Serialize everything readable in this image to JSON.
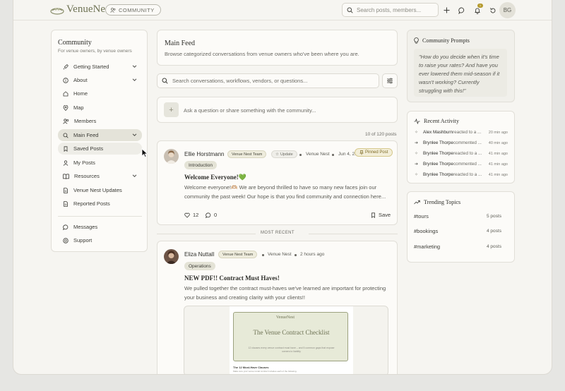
{
  "header": {
    "logo_text": "VenueNest",
    "community_label": "COMMUNITY",
    "search_placeholder": "Search posts, members...",
    "notification_count": "1",
    "avatar_initials": "BG"
  },
  "sidebar": {
    "title": "Community",
    "subtitle": "For venue owners, by venue owners",
    "items": [
      {
        "label": "Getting Started",
        "icon": "rocket-icon",
        "chevron": true
      },
      {
        "label": "About",
        "icon": "info-icon",
        "chevron": true
      },
      {
        "label": "Home",
        "icon": "home-icon",
        "chevron": false
      },
      {
        "label": "Map",
        "icon": "map-pin-icon",
        "chevron": false
      },
      {
        "label": "Members",
        "icon": "users-icon",
        "chevron": false
      },
      {
        "label": "Main Feed",
        "icon": "search-icon",
        "chevron": true
      },
      {
        "label": "Saved Posts",
        "icon": "bookmark-icon",
        "chevron": false
      },
      {
        "label": "My Posts",
        "icon": "user-icon",
        "chevron": false
      },
      {
        "label": "Resources",
        "icon": "book-icon",
        "chevron": true
      },
      {
        "label": "Venue Nest Updates",
        "icon": "document-icon",
        "chevron": false
      },
      {
        "label": "Reported Posts",
        "icon": "flag-icon",
        "chevron": false
      }
    ],
    "bottom_items": [
      {
        "label": "Messages",
        "icon": "message-icon"
      },
      {
        "label": "Support",
        "icon": "help-icon"
      }
    ]
  },
  "main": {
    "title": "Main Feed",
    "subtitle": "Browse categorized conversations from venue owners who've been where you are.",
    "search_placeholder": "Search conversations, workflows, vendors, or questions...",
    "compose_placeholder": "Ask a question or share something with the community...",
    "count_text": "10 of 120 posts",
    "divider_label": "MOST RECENT",
    "posts": [
      {
        "author": "Ellie Horstmann",
        "team_tag": "Venue Nest Team",
        "update_tag": "Update",
        "source": "Venue Nest",
        "date": "Jun 4, 2...",
        "pinned_label": "Pinned Post",
        "category": "Introduction",
        "title": "Welcome Everyone!💚",
        "body": "Welcome everyone!🫶🏼 We are beyond thrilled to have so many new faces join our community the past week! Our hope is that you find community and connection here...",
        "likes": "12",
        "comments": "0",
        "save_label": "Save"
      },
      {
        "author": "Eliza Nuttall",
        "team_tag": "Venue Nest Team",
        "source": "Venue Nest",
        "time": "2 hours ago",
        "category": "Operations",
        "title": "NEW PDF!! Contract Must Haves!",
        "body": "We pulled together the contract must-haves we've learned are important for protecting your business and creating clarity with your clients!!",
        "doc": {
          "logo": "VenueNest",
          "title": "The Venue Contract Checklist",
          "small": "12 clauses every venue contract must have – and 5 common gaps that expose owners to liability",
          "heading": "The 12 Must-Have Clauses",
          "line": "Make sure your venue rental contract includes each of the following."
        }
      }
    ]
  },
  "prompts": {
    "title": "Community Prompts",
    "quote": "\"How do you decide when it's time to raise your rates? And have you ever lowered them mid-season if it wasn't working? Currently struggling with this!\""
  },
  "activity": {
    "title": "Recent Activity",
    "rows": [
      {
        "who": "Alex Mashburn",
        "what": " reacted to a ...",
        "time": "20 min ago"
      },
      {
        "who": "Brynlee Thorpe",
        "what": " commented ...",
        "time": "40 min ago"
      },
      {
        "who": "Brynlee Thorpe",
        "what": " reacted to a ...",
        "time": "41 min ago"
      },
      {
        "who": "Brynlee Thorpe",
        "what": " commented ...",
        "time": "41 min ago"
      },
      {
        "who": "Brynlee Thorpe",
        "what": " reacted to a ...",
        "time": "41 min ago"
      }
    ]
  },
  "trending": {
    "title": "Trending Topics",
    "topics": [
      {
        "tag": "#tours",
        "count": "5 posts"
      },
      {
        "tag": "#bookings",
        "count": "4 posts"
      },
      {
        "tag": "#marketing",
        "count": "4 posts"
      }
    ]
  }
}
